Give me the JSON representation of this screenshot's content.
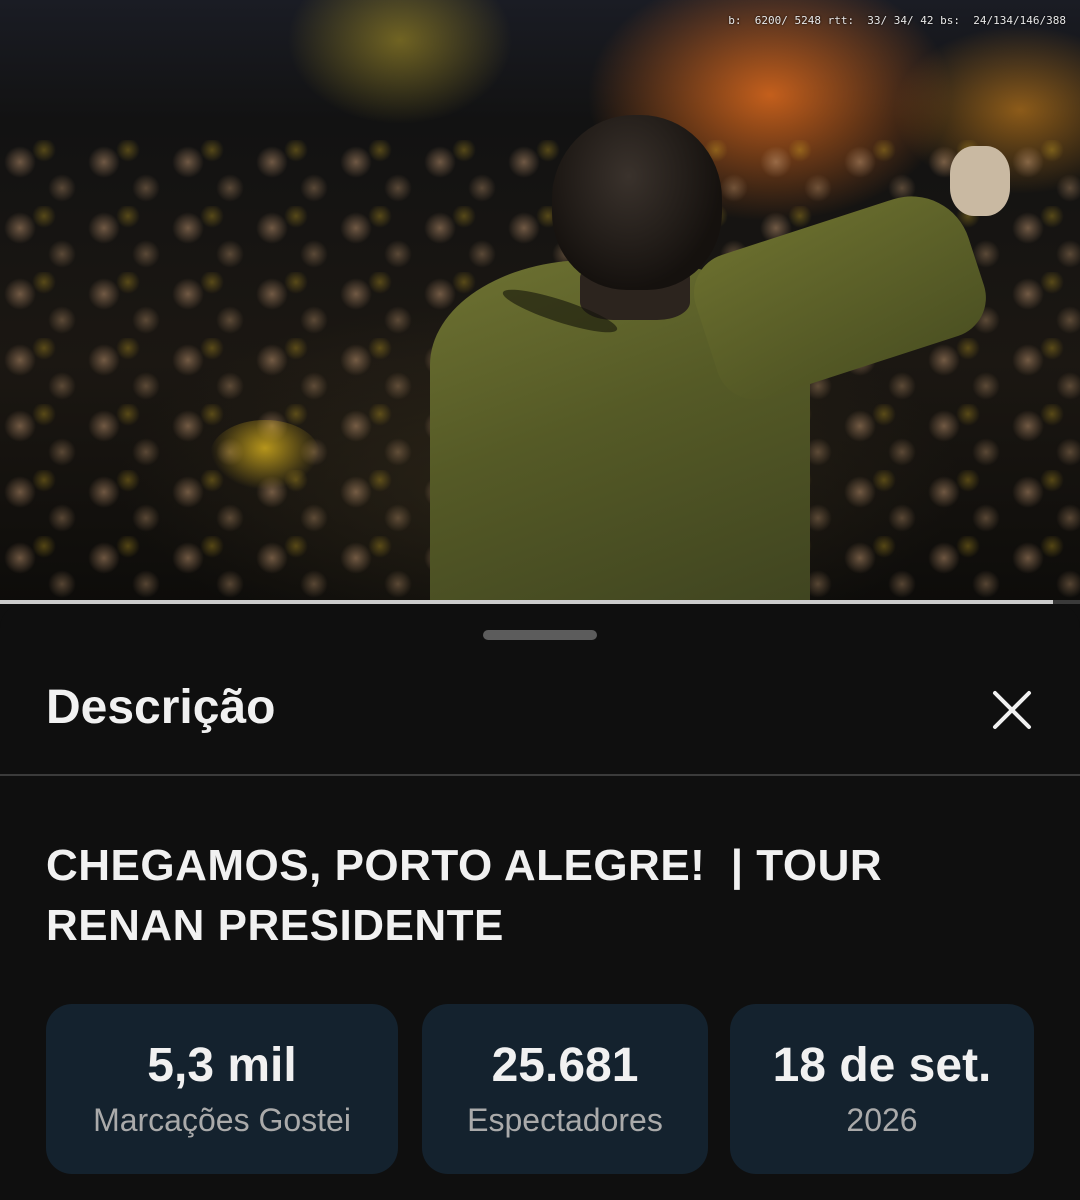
{
  "video": {
    "stats_overlay": "b:  6200/ 5248 rtt:  33/ 34/ 42 bs:  24/134/146/388",
    "progress": 0.975
  },
  "sheet": {
    "title": "Descrição",
    "close_icon": "close-icon"
  },
  "description": {
    "video_title": "CHEGAMOS, PORTO ALEGRE!  | TOUR RENAN PRESIDENTE",
    "stats": [
      {
        "value": "5,3 mil",
        "label": "Marcações Gostei"
      },
      {
        "value": "25.681",
        "label": "Espectadores"
      },
      {
        "value": "18 de set.",
        "label": "2026"
      }
    ]
  },
  "colors": {
    "background": "#0f0f0f",
    "card": "#14222e",
    "text_primary": "#f1f1f1",
    "text_secondary": "#aaaaaa"
  }
}
